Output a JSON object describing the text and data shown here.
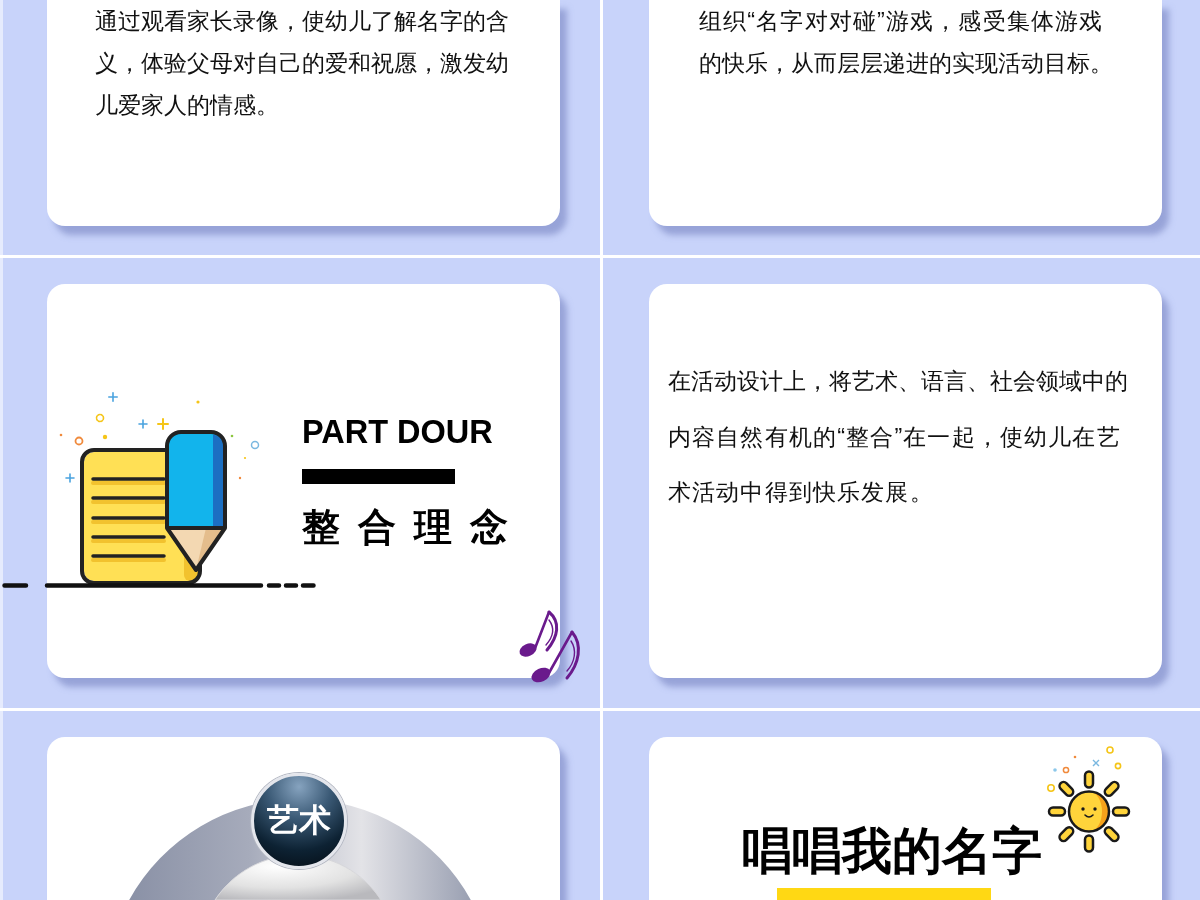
{
  "slides": [
    {
      "kind": "text",
      "paragraph": "通过观看家长录像，使幼儿了解名字的含义，体验父母对自己的爱和祝愿，激发幼儿爱家人的情感。"
    },
    {
      "kind": "text",
      "paragraph": "组织“名字对对碰”游戏，感受集体游戏的快乐，从而层层递进的实现活动目标。"
    },
    {
      "kind": "section",
      "label": "PART DOUR",
      "title": "整合理念"
    },
    {
      "kind": "text",
      "paragraph": "在活动设计上，将艺术、语言、社会领域中的内容自然有机的“整合”在一起，使幼儿在艺术活动中得到快乐发展。"
    },
    {
      "kind": "diagram",
      "badge": "艺术"
    },
    {
      "kind": "heading",
      "title": "唱唱我的名字"
    }
  ]
}
